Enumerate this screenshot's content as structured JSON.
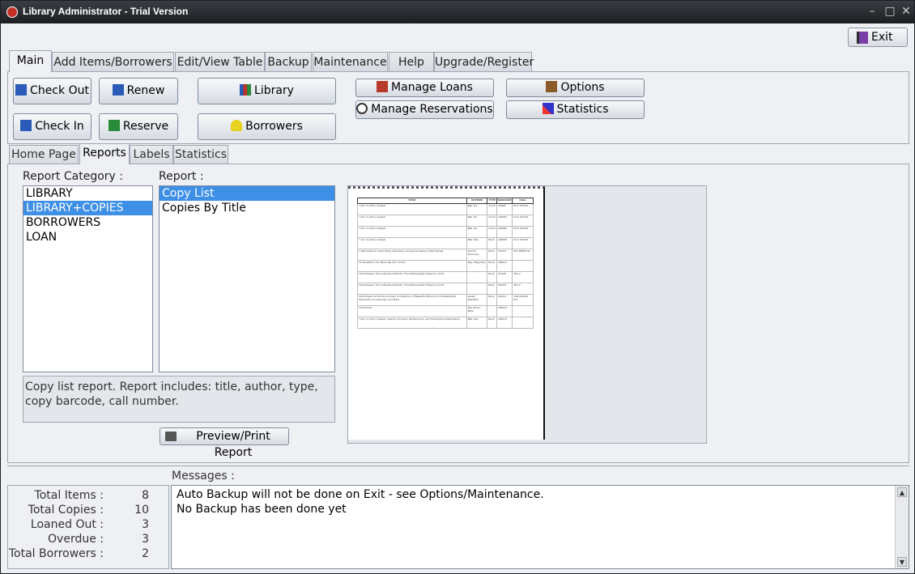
{
  "window": {
    "title": "Library Administrator - Trial Version"
  },
  "exit_label": "Exit",
  "main_tabs": [
    "Main",
    "Add Items/Borrowers",
    "Edit/View Table",
    "Backup",
    "Maintenance",
    "Help",
    "Upgrade/Register"
  ],
  "toolbar": {
    "check_out": "Check Out",
    "renew": "Renew",
    "library": "Library",
    "check_in": "Check In",
    "reserve": "Reserve",
    "borrowers": "Borrowers",
    "manage_loans": "Manage Loans",
    "manage_reservations": "Manage Reservations",
    "options": "Options",
    "statistics": "Statistics"
  },
  "sub_tabs": [
    "Home Page",
    "Reports",
    "Labels",
    "Statistics"
  ],
  "reports": {
    "category_label": "Report Category :",
    "report_label": "Report :",
    "categories": [
      "LIBRARY",
      "LIBRARY+COPIES",
      "BORROWERS",
      "LOAN"
    ],
    "reports": [
      "Copy List",
      "Copies By Title"
    ],
    "description": "Copy list report. Report includes: title, author, type, copy barcode, call number.",
    "preview_button": "Preview/Print Report"
  },
  "preview": {
    "headers": [
      "TITLE",
      "AUTHOR",
      "TYPE",
      "BARCODE",
      "CALL"
    ],
    "rows": [
      [
        "'I am' in John's Gospel",
        "Ball, Da",
        "monh",
        "L0008",
        "D.LV 333.00"
      ],
      [
        "'I am' in John's Gospel",
        "Ball, Da",
        "monh",
        "L00081",
        "D.LV 333.00"
      ],
      [
        "'I am' in John's Gospel",
        "Ball, Da",
        "monh",
        "L00082",
        "D.LV 333.00"
      ],
      [
        "'I am' in John's Gospel",
        "Ball, Dan",
        "Book",
        "L00008",
        "D.LV 333.00"
      ],
      [
        "1,000 Ideas for Decorating Cupcakes, Cookies & Cakes (1,000 Series)",
        "Sandra Sdcimary",
        "Book",
        "C0410",
        "641.86539 SL"
      ],
      [
        "10 Questions You Must ask Your Doctor",
        "Ray, Meymhan",
        "Book",
        "L00011",
        ""
      ],
      [
        "100 Dresses: The Costume Institute / The Metropolitan Museum of Art",
        "",
        "Book",
        "C0418",
        "391.2"
      ],
      [
        "100 Dresses: The Costume Institute / The Metropolitan Museum of Art",
        "",
        "Book",
        "C0418",
        "391.2"
      ],
      [
        "100 Flowers to Knit & Crochet: A Collection of Beautiful Blooms for Embellishing Garments, Accessories, and More",
        "Lesley Stanfield",
        "Book",
        "C0410",
        "746.432041 STL"
      ],
      [
        "100 Poems",
        "Van Doren, Mark",
        "",
        "L00021",
        ""
      ],
      [
        "'I am' in John's Gospel: Literary Function, Background, and Theological Implications",
        "Ball, Dan",
        "Book",
        "L00013",
        ""
      ]
    ]
  },
  "messages_label": "Messages :",
  "messages": [
    "Auto Backup will not be done on Exit - see Options/Maintenance.",
    "No Backup has been done yet"
  ],
  "stats": [
    {
      "label": "Total Items :",
      "value": "8"
    },
    {
      "label": "Total Copies :",
      "value": "10"
    },
    {
      "label": "Loaned Out :",
      "value": "3"
    },
    {
      "label": "Overdue :",
      "value": "3"
    },
    {
      "label": "Total Borrowers :",
      "value": "2"
    }
  ]
}
